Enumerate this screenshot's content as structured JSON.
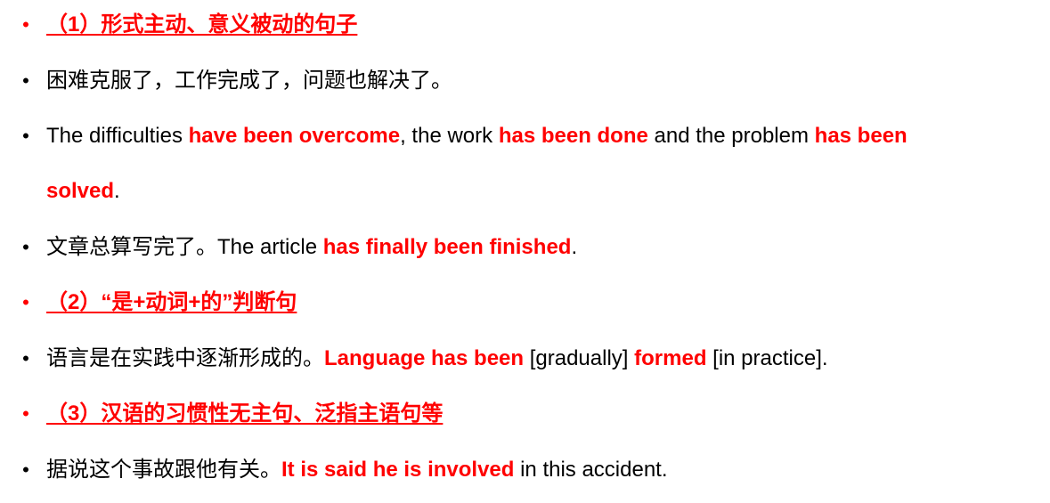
{
  "colors": {
    "accent": "#ff0000",
    "text": "#000000",
    "background": "#ffffff"
  },
  "section1": {
    "heading": "（1）形式主动、意义被动的句子",
    "example1_cn": "困难克服了，工作完成了，问题也解决了。",
    "example1_en": {
      "p1": "The difficulties ",
      "h1": "have been overcome",
      "p2": ", the work ",
      "h2": "has been done",
      "p3": " and the problem ",
      "h3": "has been",
      "h4": "solved",
      "p4": "."
    },
    "example2": {
      "cn": "文章总算写完了。",
      "p1": "The article ",
      "h1": "has finally been finished",
      "p2": "."
    }
  },
  "section2": {
    "heading": "（2）“是+动词+的”判断句",
    "example": {
      "cn": "语言是在实践中逐渐形成的。",
      "h1": "Language has been",
      "p1": " [gradually] ",
      "h2": "formed",
      "p2": " [in practice]."
    }
  },
  "section3": {
    "heading": "（3）汉语的习惯性无主句、泛指主语句等",
    "example": {
      "cn": "据说这个事故跟他有关。",
      "h1": "It is said he is involved",
      "p1": " in this accident."
    }
  },
  "bullet_glyph": "•"
}
